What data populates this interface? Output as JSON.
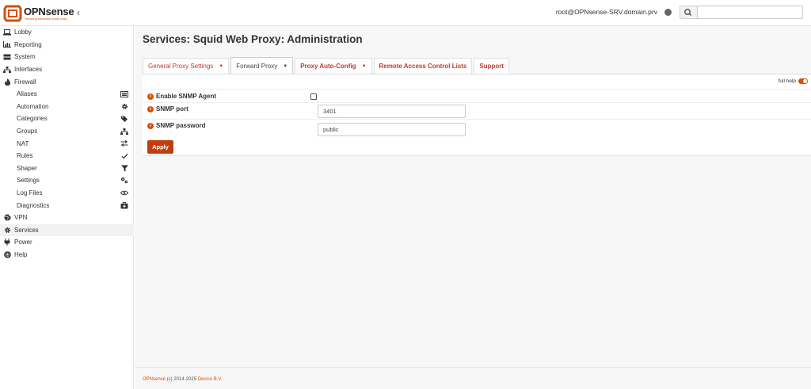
{
  "brand": {
    "name": "OPNsense",
    "tagline": "Securing networks made easy",
    "accent": "#d94f00"
  },
  "header": {
    "user": "root@OPNsense-SRV.domain.prv",
    "search_placeholder": ""
  },
  "sidebar": {
    "top": [
      {
        "label": "Lobby",
        "icon": "laptop-icon"
      },
      {
        "label": "Reporting",
        "icon": "chart-icon"
      },
      {
        "label": "System",
        "icon": "server-icon"
      },
      {
        "label": "Interfaces",
        "icon": "sitemap-icon"
      },
      {
        "label": "Firewall",
        "icon": "fire-icon"
      }
    ],
    "firewall_sub": [
      {
        "label": "Aliases",
        "icon": "list-icon"
      },
      {
        "label": "Automation",
        "icon": "gear-icon"
      },
      {
        "label": "Categories",
        "icon": "tags-icon"
      },
      {
        "label": "Groups",
        "icon": "sitemap-icon"
      },
      {
        "label": "NAT",
        "icon": "exchange-icon"
      },
      {
        "label": "Rules",
        "icon": "check-icon"
      },
      {
        "label": "Shaper",
        "icon": "filter-icon"
      },
      {
        "label": "Settings",
        "icon": "cogs-icon"
      },
      {
        "label": "Log Files",
        "icon": "eye-icon"
      },
      {
        "label": "Diagnostics",
        "icon": "medkit-icon"
      }
    ],
    "bottom": [
      {
        "label": "VPN",
        "icon": "globe-icon"
      },
      {
        "label": "Services",
        "icon": "gear-icon",
        "active": true
      },
      {
        "label": "Power",
        "icon": "plug-icon"
      },
      {
        "label": "Help",
        "icon": "lifebuoy-icon"
      }
    ]
  },
  "page": {
    "title": "Services: Squid Web Proxy: Administration",
    "tabs": [
      {
        "label": "General Proxy Settings",
        "dropdown": true
      },
      {
        "label": "Forward Proxy",
        "dropdown": true,
        "active": true
      },
      {
        "label": "Proxy Auto-Config",
        "dropdown": true
      },
      {
        "label": "Remote Access Control Lists"
      },
      {
        "label": "Support"
      }
    ],
    "full_help": "full help",
    "fields": {
      "enable_snmp_label": "Enable SNMP Agent",
      "enable_snmp_checked": false,
      "snmp_port_label": "SNMP port",
      "snmp_port_value": "3401",
      "snmp_password_label": "SNMP password",
      "snmp_password_value": "public"
    },
    "apply_label": "Apply"
  },
  "footer": {
    "prefix": "OPNsense",
    "middle": " (c) 2014-2025 ",
    "company": "Deciso B.V."
  }
}
